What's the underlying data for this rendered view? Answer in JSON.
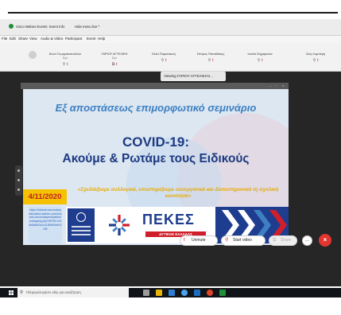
{
  "titlebar": {
    "app_name": "Cisco Webex Events",
    "event_info": "Event Info",
    "hide_menu": "Hide menu bar ^"
  },
  "menubar": {
    "items": [
      "File",
      "Edit",
      "Share",
      "View",
      "Audio & Video",
      "Participant",
      "Event",
      "Help"
    ]
  },
  "participants": [
    {
      "name": "Άννα Γεωργακοπούλου",
      "sub": "Εγώ"
    },
    {
      "name": "ΓΑΡΙΟΥ ΑΓΓΕΛΙΚΗ",
      "sub": "Εγώ"
    },
    {
      "name": "Κέλα Παρασκευή",
      "sub": ""
    },
    {
      "name": "Σπύρος Παπαδάκης",
      "sub": ""
    },
    {
      "name": "Ιουλία Ζαχαρούλα",
      "sub": ""
    },
    {
      "name": "Ζώη Λυμπέρη",
      "sub": ""
    }
  ],
  "viewing_label": "Viewing ΓΑΡΙΟΥ ΑΓΓΕΛΙΚΗ's...",
  "slide": {
    "title": "Εξ αποστάσεως επιμορφωτικό σεμινάριο",
    "covid": "COVID-19:",
    "subtitle": "Ακούμε & Ρωτάμε τους Ειδικούς",
    "date": "4/11/2020",
    "quote": "«Σχεδιάζουμε συλλογικά, υποστηρίζουμε συνεργατικά και διεπιστημονικά τη σχολική κοινότητα»",
    "url": "https://minedu.secondaryeducation.webex.com/minedu-secondaryeducation/onstage/g.php?MTID=e1f4b6d8e2a1c1189b94eb1005f",
    "org": "ΠΕΚΕΣ",
    "region": "ΔΥΤΙΚΗΣ ΕΛΛΑΔΑΣ",
    "colors": {
      "title_blue": "#3d7fc1",
      "navy": "#1d3a82",
      "date_yellow": "#f5c100",
      "date_red": "#c0202a",
      "quote_gold": "#e8a900"
    }
  },
  "controls": {
    "unmute": "Unmute",
    "start_video": "Start video",
    "share": "Share",
    "more": "...",
    "end": "×",
    "colors": {
      "end_red": "#e2352f",
      "accent_red": "#d02a2a"
    }
  },
  "taskbar": {
    "search_placeholder": "Πληκτρολογήστε εδώ για αναζήτηση"
  },
  "icons": [
    "webex-logo-icon",
    "mic-muted-icon",
    "camera-off-icon",
    "windows-logo-icon",
    "search-icon",
    "share-icon",
    "more-icon",
    "end-call-icon"
  ]
}
